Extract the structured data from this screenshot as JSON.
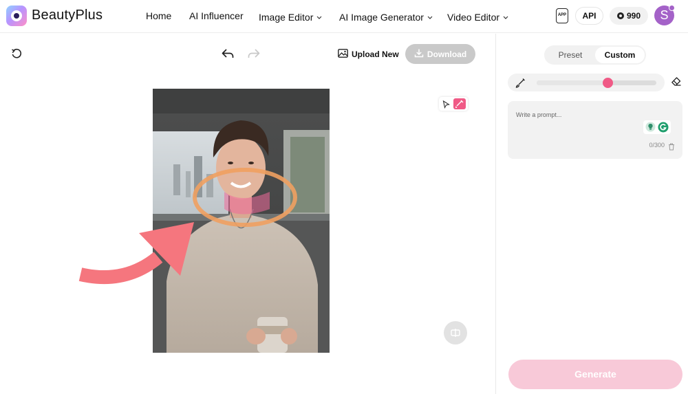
{
  "app": {
    "brand": "BeautyPlus"
  },
  "nav": {
    "items": [
      {
        "label": "Home",
        "has_dropdown": false
      },
      {
        "label": "AI Influencer",
        "has_dropdown": false
      },
      {
        "label": "Image Editor",
        "has_dropdown": true
      },
      {
        "label": "AI Image Generator",
        "has_dropdown": true
      },
      {
        "label": "Video Editor",
        "has_dropdown": true
      }
    ]
  },
  "header_actions": {
    "app_label": "APP",
    "api_label": "API",
    "credits": "990",
    "avatar_initial": "S"
  },
  "toolbar": {
    "reset_icon": "rotate-ccw-icon",
    "undo_icon": "undo-icon",
    "redo_icon": "redo-icon",
    "upload_label": "Upload New",
    "download_label": "Download"
  },
  "panel": {
    "tabs": [
      {
        "label": "Preset",
        "active": false
      },
      {
        "label": "Custom",
        "active": true
      }
    ],
    "brush_size": 0.59,
    "prompt_placeholder": "Write a prompt...",
    "prompt_value": "",
    "char_count": "0/300",
    "generate_label": "Generate"
  },
  "colors": {
    "accent": "#f05a86",
    "generate_disabled": "#f8c9d8",
    "download_disabled": "#c9c9c9",
    "avatar": "#a462c8",
    "mask_ring": "#f0a060",
    "arrow": "#f5767e"
  }
}
